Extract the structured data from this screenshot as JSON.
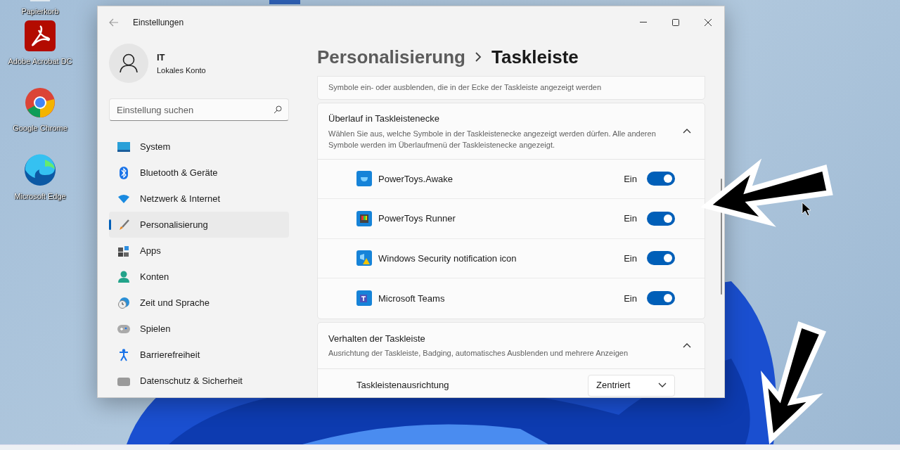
{
  "desktop_icons": [
    {
      "label": "Papierkorb"
    },
    {
      "label": "Adobe Acrobat DC"
    },
    {
      "label": "Google Chrome"
    },
    {
      "label": "Microsoft Edge"
    }
  ],
  "window": {
    "title": "Einstellungen",
    "account": {
      "name": "IT",
      "type": "Lokales Konto"
    },
    "search": {
      "placeholder": "Einstellung suchen"
    },
    "nav_items": [
      {
        "label": "System",
        "selected": false
      },
      {
        "label": "Bluetooth & Geräte",
        "selected": false
      },
      {
        "label": "Netzwerk & Internet",
        "selected": false
      },
      {
        "label": "Personalisierung",
        "selected": true
      },
      {
        "label": "Apps",
        "selected": false
      },
      {
        "label": "Konten",
        "selected": false
      },
      {
        "label": "Zeit und Sprache",
        "selected": false
      },
      {
        "label": "Spielen",
        "selected": false
      },
      {
        "label": "Barrierefreiheit",
        "selected": false
      },
      {
        "label": "Datenschutz & Sicherheit",
        "selected": false
      }
    ],
    "breadcrumb": [
      "Personalisierung",
      "Taskleiste"
    ],
    "partial_card": {
      "description": "Symbole ein- oder ausblenden, die in der Ecke der Taskleiste angezeigt werden"
    },
    "overflow_section": {
      "title": "Überlauf in Taskleistenecke",
      "description": "Wählen Sie aus, welche Symbole in der Taskleistenecke angezeigt werden dürfen. Alle anderen Symbole werden im Überlaufmenü der Taskleistenecke angezeigt.",
      "expanded": true,
      "items": [
        {
          "name": "PowerToys.Awake",
          "state_label": "Ein",
          "on": true
        },
        {
          "name": "PowerToys Runner",
          "state_label": "Ein",
          "on": true
        },
        {
          "name": "Windows Security notification icon",
          "state_label": "Ein",
          "on": true
        },
        {
          "name": "Microsoft Teams",
          "state_label": "Ein",
          "on": true
        }
      ]
    },
    "behavior_section": {
      "title": "Verhalten der Taskleiste",
      "description": "Ausrichtung der Taskleiste, Badging, automatisches Ausblenden und mehrere Anzeigen",
      "expanded": true,
      "settings": [
        {
          "label": "Taskleistenausrichtung",
          "value": "Zentriert"
        }
      ]
    }
  }
}
